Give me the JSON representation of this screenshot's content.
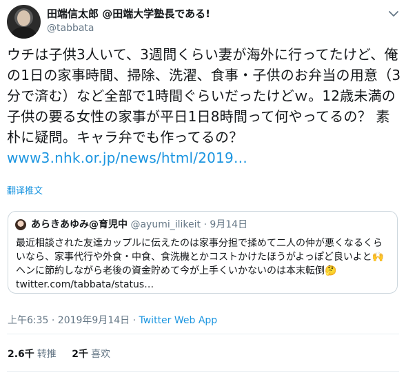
{
  "author": {
    "display_name": "田端信太郎 @田端大学塾長である!",
    "handle": "@tabbata"
  },
  "tweet": {
    "text": "ウチは子供3人いて、3週間くらい妻が海外に行ってたけど、俺の1日の家事時間、掃除、洗濯、食事・子供のお弁当の用意（3分で済む）など全部で1時間ぐらいだったけどｗ。12歳未満の子供の要る女性の家事が平日1日8時間って何やってるの？ 素朴に疑問。キャラ弁でも作ってるの？ ",
    "link": "www3.nhk.or.jp/news/html/2019…"
  },
  "translate_label": "翻译推文",
  "quoted_tweet": {
    "display_name": "あらきあゆみ@育児中",
    "handle": "@ayumi_ilikeit",
    "separator": "·",
    "date": "9月14日",
    "text": "最近相談された友達カップルに伝えたのは家事分担で揉めて二人の仲が悪くなるくらいなら、家事代行や外食・中食、食洗機とかコストかけたほうがよっぽど良いよと🙌ヘンに節約しながら老後の資金貯めて今が上手くいかないのは本末転倒🤔 twitter.com/tabbata/status…"
  },
  "meta": {
    "timestamp": "上午6:35 · 2019年9月14日 · ",
    "client": "Twitter Web App"
  },
  "stats": {
    "retweets_count": "2.6千",
    "retweets_label": "转推",
    "likes_count": "2千",
    "likes_label": "喜欢"
  },
  "colors": {
    "link": "#1b95e0",
    "secondary_text": "#657786",
    "border": "#ccd6dd"
  },
  "icons": {
    "menu": "chevron-down-icon"
  }
}
